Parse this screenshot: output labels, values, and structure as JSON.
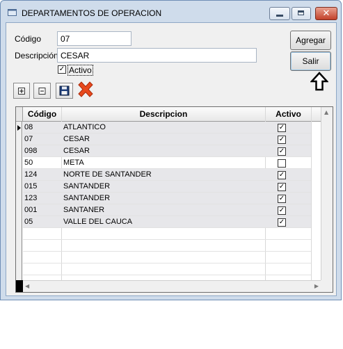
{
  "window": {
    "title": "DEPARTAMENTOS DE OPERACION",
    "close_glyph": "✕"
  },
  "form": {
    "codigo_label": "Código",
    "codigo_value": "07",
    "descripcion_label": "Descripción",
    "descripcion_value": "CESAR",
    "activo_label": "Activo",
    "activo_checked": true,
    "check_glyph": "✓"
  },
  "buttons": {
    "agregar": "Agregar",
    "salir": "Salir"
  },
  "toolbar": {
    "icons": [
      "add-record-icon",
      "remove-record-icon",
      "save-icon",
      "delete-icon"
    ]
  },
  "grid": {
    "headers": [
      "Código",
      "Descripcion",
      "Activo"
    ],
    "rows": [
      {
        "codigo": "08",
        "descripcion": "ATLANTICO",
        "activo": true
      },
      {
        "codigo": "07",
        "descripcion": "CESAR",
        "activo": true
      },
      {
        "codigo": "098",
        "descripcion": "CESAR",
        "activo": true
      },
      {
        "codigo": "50",
        "descripcion": "META",
        "activo": false
      },
      {
        "codigo": "124",
        "descripcion": "NORTE DE SANTANDER",
        "activo": true
      },
      {
        "codigo": "015",
        "descripcion": "SANTANDER",
        "activo": true
      },
      {
        "codigo": "123",
        "descripcion": "SANTANDER",
        "activo": true
      },
      {
        "codigo": "001",
        "descripcion": "SANTANER",
        "activo": true
      },
      {
        "codigo": "05",
        "descripcion": "VALLE DEL CAUCA",
        "activo": true
      }
    ],
    "current_row": 0
  },
  "colors": {
    "delete_red": "#e8491d",
    "title_bg": "#cfdceb"
  }
}
